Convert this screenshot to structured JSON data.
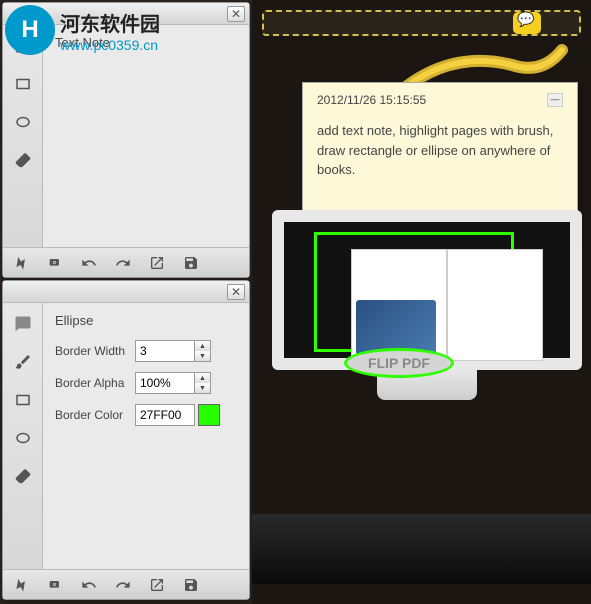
{
  "watermark": {
    "title": "河东软件园",
    "url": "www.pc0359.cn"
  },
  "panel1": {
    "title": "Text Note"
  },
  "panel2": {
    "title": "Ellipse",
    "border_width_label": "Border Width",
    "border_width_value": "3",
    "border_alpha_label": "Border Alpha",
    "border_alpha_value": "100%",
    "border_color_label": "Border Color",
    "border_color_value": "27FF00",
    "border_color_hex": "#27FF00"
  },
  "sticky": {
    "timestamp": "2012/11/26 15:15:55",
    "body": "add text note, highlight pages with brush, draw rectangle or ellipse on anywhere of books."
  },
  "flip_label": "FLIP PDF"
}
